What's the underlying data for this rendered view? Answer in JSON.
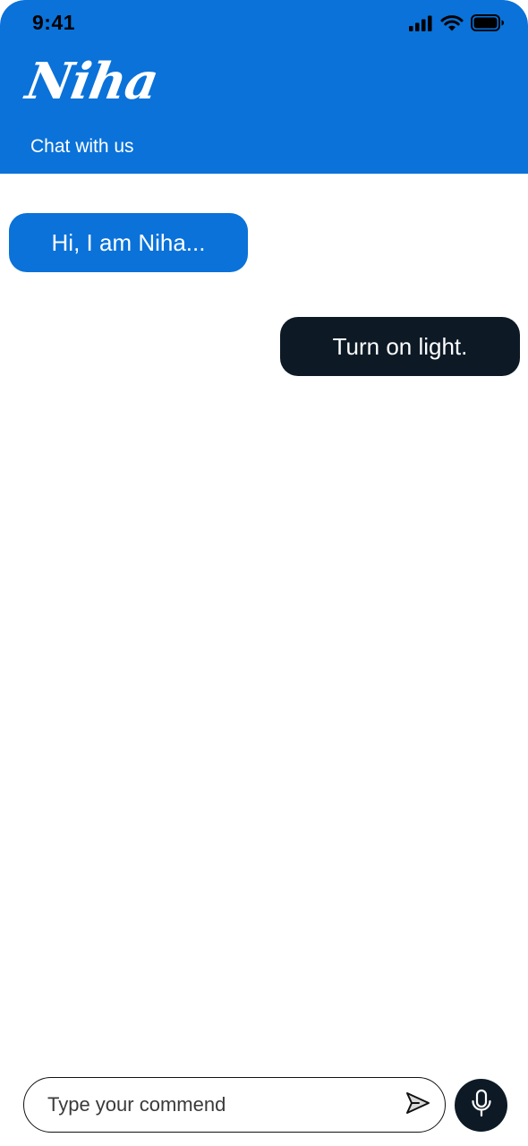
{
  "status_bar": {
    "time": "9:41",
    "icons": [
      "signal-icon",
      "wifi-icon",
      "battery-icon"
    ]
  },
  "header": {
    "brand": "Niha",
    "subtitle": "Chat with us",
    "background_color": "#0A72D9"
  },
  "messages": [
    {
      "sender": "bot",
      "text": "Hi, I am Niha...",
      "color": "#0A72D9"
    },
    {
      "sender": "user",
      "text": "Turn on light.",
      "color": "#0D1A26"
    }
  ],
  "composer": {
    "placeholder": "Type your commend",
    "value": "",
    "send_icon": "send-icon",
    "mic_icon": "microphone-icon"
  }
}
